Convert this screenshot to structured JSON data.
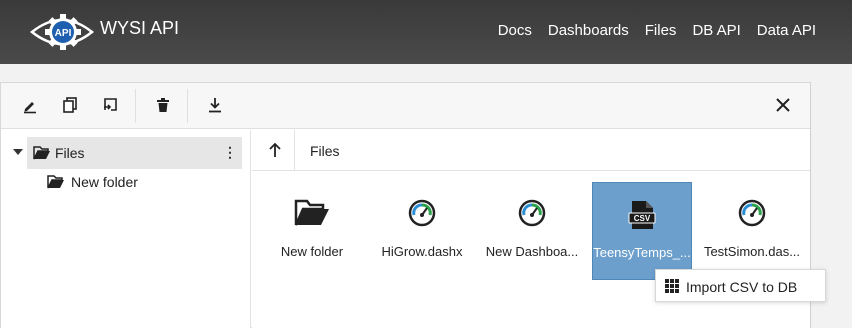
{
  "header": {
    "logo_text": "API",
    "brand": "WYSI API",
    "nav": [
      "Docs",
      "Dashboards",
      "Files",
      "DB API",
      "Data API"
    ]
  },
  "tree": {
    "root": "Files",
    "children": [
      "New folder"
    ]
  },
  "path": {
    "current": "Files"
  },
  "files": [
    {
      "name": "New folder",
      "type": "folder",
      "selected": false
    },
    {
      "name": "HiGrow.dashx",
      "type": "dashboard",
      "selected": false
    },
    {
      "name": "New Dashboa...",
      "type": "dashboard",
      "selected": false
    },
    {
      "name": "TeensyTemps_...",
      "type": "csv",
      "selected": true
    },
    {
      "name": "TestSimon.das...",
      "type": "dashboard",
      "selected": false
    }
  ],
  "context_menu": {
    "item": "Import CSV to DB"
  },
  "icons": {
    "toolbar": [
      "rename-icon",
      "copy-icon",
      "move-icon",
      "delete-icon",
      "download-icon",
      "close-icon"
    ]
  },
  "colors": {
    "header_bg": "#3f3f3f",
    "selection": "#6d9fcd",
    "gauge_accent": "#2b8fd6"
  }
}
